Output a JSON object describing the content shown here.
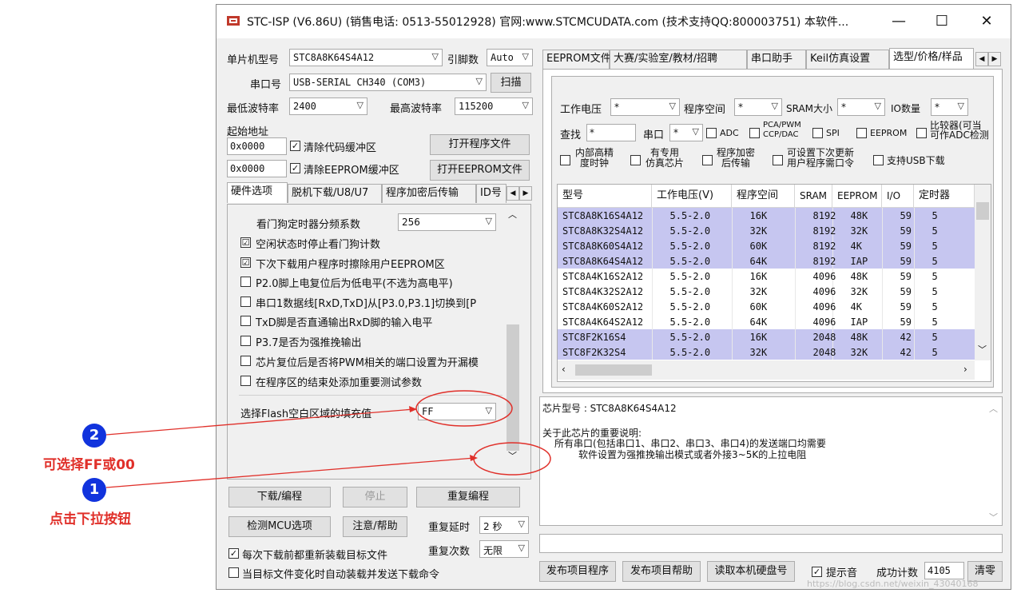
{
  "window": {
    "title": "STC-ISP (V6.86U) (销售电话: 0513-55012928) 官网:www.STCMCUDATA.com  (技术支持QQ:800003751) 本软件...",
    "minimize": "—",
    "maximize": "☐",
    "close": "✕"
  },
  "left": {
    "mcu_label": "单片机型号",
    "mcu_value": "STC8A8K64S4A12",
    "pin_label": "引脚数",
    "pin_value": "Auto",
    "port_label": "串口号",
    "port_value": "USB-SERIAL CH340 (COM3)",
    "scan_button": "扫描",
    "min_baud_label": "最低波特率",
    "min_baud_value": "2400",
    "max_baud_label": "最高波特率",
    "max_baud_value": "115200",
    "start_addr_label": "起始地址",
    "addr1_value": "0x0000",
    "clear_code_label": "清除代码缓冲区",
    "open_prog_button": "打开程序文件",
    "addr2_value": "0x0000",
    "clear_eeprom_label": "清除EEPROM缓冲区",
    "open_eeprom_button": "打开EEPROM文件"
  },
  "left_tabs": [
    "硬件选项",
    "脱机下载/U8/U7",
    "程序加密后传输",
    "ID号"
  ],
  "options": {
    "watchdog_label": "看门狗定时器分频系数",
    "watchdog_value": "256",
    "items": [
      {
        "label": "空闲状态时停止看门狗计数",
        "checked": "☑"
      },
      {
        "label": "下次下载用户程序时擦除用户EEPROM区",
        "checked": "☑"
      },
      {
        "label": "P2.0脚上电复位后为低电平(不选为高电平)",
        "checked": ""
      },
      {
        "label": "串口1数据线[RxD,TxD]从[P3.0,P3.1]切换到[P",
        "checked": ""
      },
      {
        "label": "TxD脚是否直通输出RxD脚的输入电平",
        "checked": ""
      },
      {
        "label": "P3.7是否为强推挽输出",
        "checked": ""
      },
      {
        "label": "芯片复位后是否将PWM相关的端口设置为开漏模",
        "checked": ""
      },
      {
        "label": "在程序区的结束处添加重要测试参数",
        "checked": ""
      }
    ],
    "fill_label": "选择Flash空白区域的填充值",
    "fill_value": "FF"
  },
  "bottom_left": {
    "download_button": "下载/编程",
    "stop_button": "停止",
    "reprogram_button": "重复编程",
    "detect_button": "检测MCU选项",
    "help_button": "注意/帮助",
    "delay_label": "重复延时",
    "delay_value": "2 秒",
    "count_label": "重复次数",
    "count_value": "无限",
    "reload_label": "每次下载前都重新装载目标文件",
    "auto_label": "当目标文件变化时自动装载并发送下载命令"
  },
  "right_tabs": [
    "EEPROM文件",
    "大赛/实验室/教材/招聘",
    "串口助手",
    "Keil仿真设置",
    "选型/价格/样品"
  ],
  "filter": {
    "voltage_label": "工作电压",
    "voltage_value": "*",
    "progspace_label": "程序空间",
    "progspace_value": "*",
    "sram_label": "SRAM大小",
    "sram_value": "*",
    "io_label": "IO数量",
    "io_value": "*",
    "search_label": "查找",
    "search_value": "*",
    "uart_label": "串口",
    "uart_value": "*",
    "adc_label": "ADC",
    "pca_label_1": "PCA/PWM",
    "pca_label_2": "CCP/DAC",
    "spi_label": "SPI",
    "eeprom_label": "EEPROM",
    "comp_label_1": "比较器(可当",
    "comp_label_2": "可作ADC检测",
    "irc_label_1": "内部高精",
    "irc_label_2": "度时钟",
    "emu_label_1": "有专用",
    "emu_label_2": "仿真芯片",
    "enc_label_1": "程序加密",
    "enc_label_2": "后传输",
    "pw_label_1": "可设置下次更新",
    "pw_label_2": "用户程序需口令",
    "usb_label": "支持USB下载"
  },
  "chip_table": {
    "headers": [
      "型号",
      "工作电压(V)",
      "程序空间",
      "SRAM",
      "EEPROM",
      "I/O",
      "定时器"
    ],
    "rows": [
      [
        "STC8A8K16S4A12",
        "5.5-2.0",
        "16K",
        "8192",
        "48K",
        "59",
        "5"
      ],
      [
        "STC8A8K32S4A12",
        "5.5-2.0",
        "32K",
        "8192",
        "32K",
        "59",
        "5"
      ],
      [
        "STC8A8K60S4A12",
        "5.5-2.0",
        "60K",
        "8192",
        "4K",
        "59",
        "5"
      ],
      [
        "STC8A8K64S4A12",
        "5.5-2.0",
        "64K",
        "8192",
        "IAP",
        "59",
        "5"
      ],
      [
        "STC8A4K16S2A12",
        "5.5-2.0",
        "16K",
        "4096",
        "48K",
        "59",
        "5"
      ],
      [
        "STC8A4K32S2A12",
        "5.5-2.0",
        "32K",
        "4096",
        "32K",
        "59",
        "5"
      ],
      [
        "STC8A4K60S2A12",
        "5.5-2.0",
        "60K",
        "4096",
        "4K",
        "59",
        "5"
      ],
      [
        "STC8A4K64S2A12",
        "5.5-2.0",
        "64K",
        "4096",
        "IAP",
        "59",
        "5"
      ],
      [
        "STC8F2K16S4",
        "5.5-2.0",
        "16K",
        "2048",
        "48K",
        "42",
        "5"
      ],
      [
        "STC8F2K32S4",
        "5.5-2.0",
        "32K",
        "2048",
        "32K",
        "42",
        "5"
      ]
    ],
    "highlighted": [
      0,
      1,
      2,
      3,
      8,
      9
    ]
  },
  "info": {
    "chip_line": "芯片型号 : STC8A8K64S4A12",
    "note_title": "关于此芯片的重要说明:",
    "note_line1": "所有串口(包括串口1、串口2、串口3、串口4)的发送端口均需要",
    "note_line2": "软件设置为强推挽输出模式或者外接3~5K的上拉电阻"
  },
  "bottom_right": {
    "publish_button": "发布项目程序",
    "publish_help_button": "发布项目帮助",
    "read_disk_button": "读取本机硬盘号",
    "sound_label": "提示音",
    "success_label": "成功计数",
    "success_value": "4105",
    "clear_button": "清零"
  },
  "annotations": {
    "num1": "1",
    "text1": "点击下拉按钮",
    "num2": "2",
    "text2": "可选择FF或00",
    "accent": "#e0302a",
    "badge": "#1133dd"
  },
  "watermark": "https://blog.csdn.net/weixin_43040168"
}
